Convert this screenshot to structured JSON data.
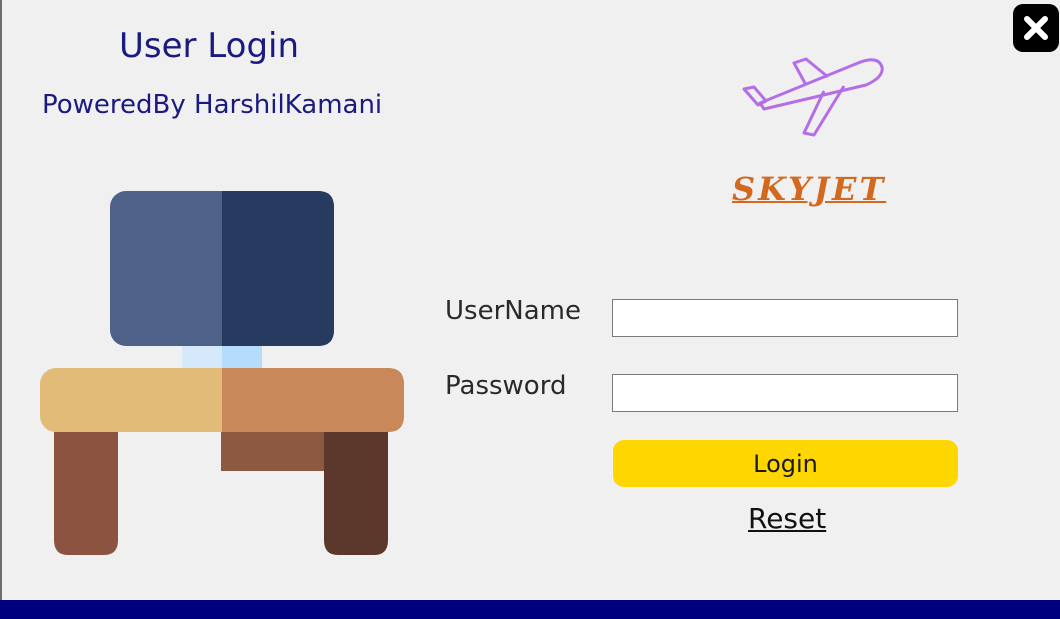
{
  "window": {
    "title": "User Login",
    "subtitle": "PoweredBy HarshilKamani"
  },
  "brand": {
    "logo_icon": "airplane-icon",
    "name": "SKYJET"
  },
  "form": {
    "username_label": "UserName",
    "username_value": "",
    "password_label": "Password",
    "password_value": "",
    "login_label": "Login",
    "reset_label": "Reset"
  },
  "icons": {
    "close": "close-icon",
    "illustration": "computer-desk-icon"
  },
  "colors": {
    "title_text": "#1a1a80",
    "login_button": "#ffd700",
    "brand_text": "#d2691e",
    "footer_bar": "#00007f",
    "background": "#f0f0f0"
  }
}
